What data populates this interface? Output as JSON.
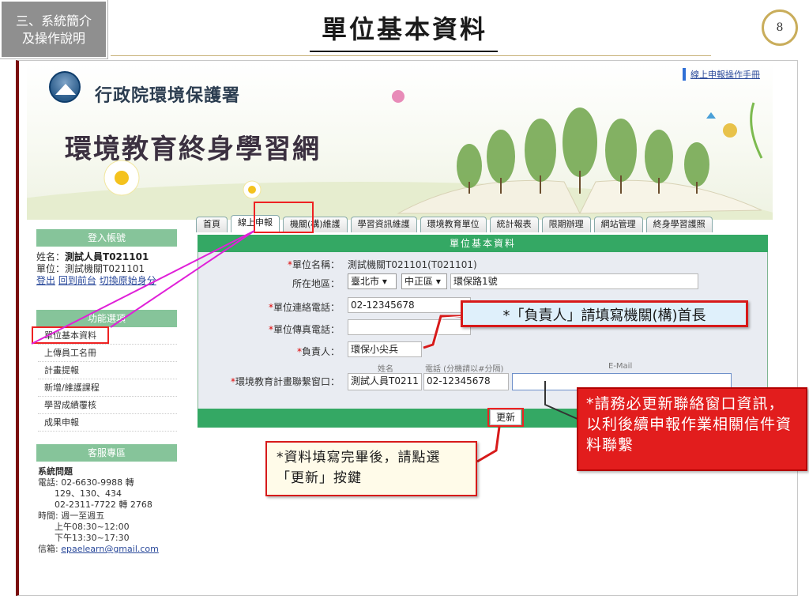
{
  "slide": {
    "section_line1": "三、系統簡介",
    "section_line2": "及操作說明",
    "title": "單位基本資料",
    "page_number": "8"
  },
  "site": {
    "agency_name": "行政院環境保護署",
    "site_name": "環境教育終身學習網",
    "manual_link": "線上申報操作手冊"
  },
  "tabs": [
    {
      "label": "首頁"
    },
    {
      "label": "線上申報",
      "active": true
    },
    {
      "label": "機關(構)維護"
    },
    {
      "label": "學習資訊維護"
    },
    {
      "label": "環境教育單位"
    },
    {
      "label": "統計報表"
    },
    {
      "label": "限期辦理"
    },
    {
      "label": "網站管理"
    },
    {
      "label": "終身學習護照"
    }
  ],
  "sidebar": {
    "login_head": "登入帳號",
    "name_label": "姓名：",
    "name_value": "測試人員T021101",
    "unit_label": "單位：",
    "unit_value": "測試機關T021101",
    "link_logout": "登出",
    "link_back": "回到前台",
    "link_switch": "切換原始身分",
    "func_head": "功能選項",
    "menu": [
      {
        "label": "單位基本資料",
        "selected": true
      },
      {
        "label": "上傳員工名冊"
      },
      {
        "label": "計畫提報"
      },
      {
        "label": "新增/維護課程"
      },
      {
        "label": "學習成績覆核"
      },
      {
        "label": "成果申報"
      }
    ],
    "service_head": "客服專區",
    "contact": {
      "title": "系統問題",
      "phone_line1": "電話: 02-6630-9988 轉",
      "phone_line2": "      129、130、434",
      "phone_line3": "      02-2311-7722 轉 2768",
      "time_line1": "時間: 週一至週五",
      "time_line2": "      上午08:30~12:00",
      "time_line3": "      下午13:30~17:30",
      "mail_label": "信箱: ",
      "mail_value": "epaelearn@gmail.com"
    }
  },
  "form": {
    "title": "單位基本資料",
    "unit_name_label": "單位名稱：",
    "unit_name_value": "測試機關T021101(T021101)",
    "region_label": "所在地區：",
    "city": "臺北市",
    "district": "中正區",
    "address": "環保路1號",
    "phone_label": "單位連絡電話：",
    "phone_value": "02-12345678",
    "fax_label": "單位傳真電話：",
    "fax_value": "",
    "head_label": "負責人：",
    "head_value": "環保小尖兵",
    "contact_label": "環境教育計畫聯繫窗口：",
    "contact_sub_name": "姓名",
    "contact_sub_phone": "電話 (分機請以#分隔)",
    "contact_sub_email": "E-Mail",
    "contact_name_value": "測試人員T0211",
    "contact_phone_value": "02-12345678",
    "contact_email_value": "",
    "update_button": "更新"
  },
  "callouts": {
    "head_hint": "*「負責人」請填寫機關(構)首長",
    "contact_hint": "*請務必更新聯絡窗口資訊，以利後續申報作業相關信件資料聯繫",
    "update_hint": "*資料填寫完畢後，請點選「更新」按鍵"
  },
  "colors": {
    "green_header": "#34a864",
    "sidebar_green": "#86c49a",
    "highlight_red": "#e22222",
    "callout_red": "#e21d1d",
    "pointer_magenta": "#e020d8"
  }
}
